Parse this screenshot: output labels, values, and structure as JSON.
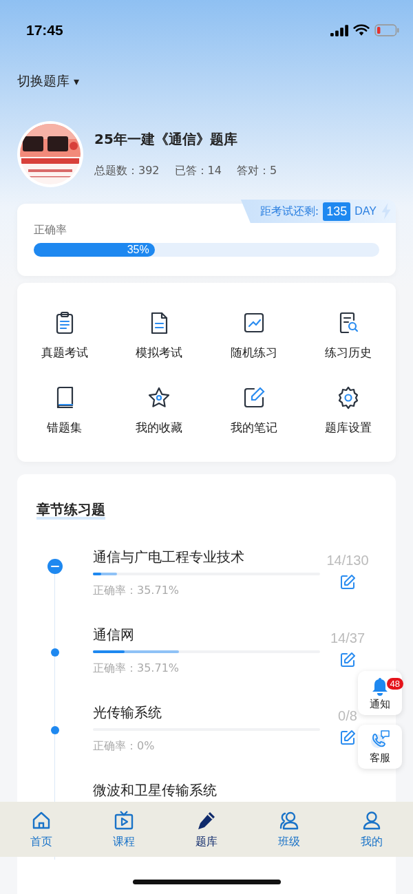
{
  "status_bar": {
    "time": "17:45"
  },
  "switcher": {
    "label": "切换题库",
    "caret": "▾"
  },
  "bank": {
    "kind": "picture",
    "title": "25年一建《通信》题库",
    "stats": [
      {
        "label": "总题数：",
        "value": "392"
      },
      {
        "label": "已答：",
        "value": "14"
      },
      {
        "label": "答对：",
        "value": "5"
      }
    ]
  },
  "accuracy_card": {
    "countdown_label": "距考试还剩:",
    "countdown_days": "135",
    "countdown_unit": "DAY",
    "label": "正确率",
    "level": 0.35,
    "reading": "35%"
  },
  "tools": [
    {
      "kind": "clipboard",
      "label": "真题考试"
    },
    {
      "kind": "document",
      "label": "模拟考试"
    },
    {
      "kind": "chart",
      "label": "随机练习"
    },
    {
      "kind": "history",
      "label": "练习历史"
    },
    {
      "kind": "book",
      "label": "错题集"
    },
    {
      "kind": "star",
      "label": "我的收藏"
    },
    {
      "kind": "note",
      "label": "我的笔记"
    },
    {
      "kind": "gear",
      "label": "题库设置"
    }
  ],
  "chapters_section": {
    "title": "章节练习题",
    "chapters": [
      {
        "title": "通信与广电工程专业技术",
        "expanded": true,
        "answered": {
          "level": 0.106
        },
        "correct": {
          "level": 0.036
        },
        "rate": "正确率：35.71%",
        "count": "14/130"
      },
      {
        "title": "通信网",
        "expanded": false,
        "answered": {
          "level": 0.38
        },
        "correct": {
          "level": 0.14
        },
        "rate": "正确率：35.71%",
        "count": "14/37"
      },
      {
        "title": "光传输系统",
        "expanded": false,
        "answered": {
          "level": 0
        },
        "correct": {
          "level": 0
        },
        "rate": "正确率：0%",
        "count": "0/8"
      },
      {
        "title": "微波和卫星传输系统"
      }
    ]
  },
  "floating": [
    {
      "kind": "bell",
      "label": "通知",
      "badge": "48"
    },
    {
      "kind": "phone",
      "label": "客服"
    }
  ],
  "tab_bar": [
    {
      "kind": "home",
      "label": "首页",
      "selected": false
    },
    {
      "kind": "tv",
      "label": "课程",
      "selected": false
    },
    {
      "kind": "pencil",
      "label": "题库",
      "selected": true
    },
    {
      "kind": "group",
      "label": "班级",
      "selected": false
    },
    {
      "kind": "person",
      "label": "我的",
      "selected": false
    }
  ]
}
